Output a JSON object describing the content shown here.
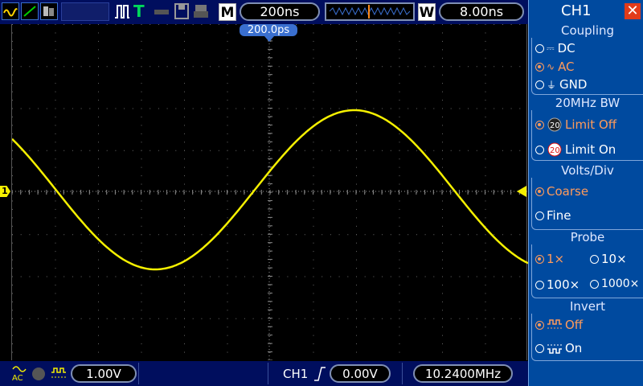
{
  "topbar": {
    "timebase": "200ns",
    "window_letter": "W",
    "window_value": "8.00ns",
    "menu_letter": "M",
    "trigger_status": "T",
    "trigger_position": "200.0ps"
  },
  "bottombar": {
    "ch1_volts": "1.00V",
    "trigger_source": "CH1",
    "trigger_level": "0.00V",
    "frequency": "10.2400MHz"
  },
  "channel_marker": "1",
  "menu": {
    "title": "CH1",
    "close_icon": "close-icon",
    "coupling": {
      "title": "Coupling",
      "options": [
        "DC",
        "AC",
        "GND"
      ],
      "selected": "AC"
    },
    "bandwidth": {
      "title": "20MHz BW",
      "options": [
        "Limit Off",
        "Limit On"
      ],
      "selected": "Limit Off"
    },
    "volts_div": {
      "title": "Volts/Div",
      "options": [
        "Coarse",
        "Fine"
      ],
      "selected": "Coarse"
    },
    "probe": {
      "title": "Probe",
      "options": [
        "1×",
        "10×",
        "100×",
        "1000×"
      ],
      "selected": "1×"
    },
    "invert": {
      "title": "Invert",
      "options": [
        "Off",
        "On"
      ],
      "selected": "Off"
    }
  },
  "colors": {
    "trace": "#f5f000",
    "menu_bg": "#004a9f",
    "topbar_bg": "#000e5e",
    "selected_option": "#ff9b5b"
  }
}
